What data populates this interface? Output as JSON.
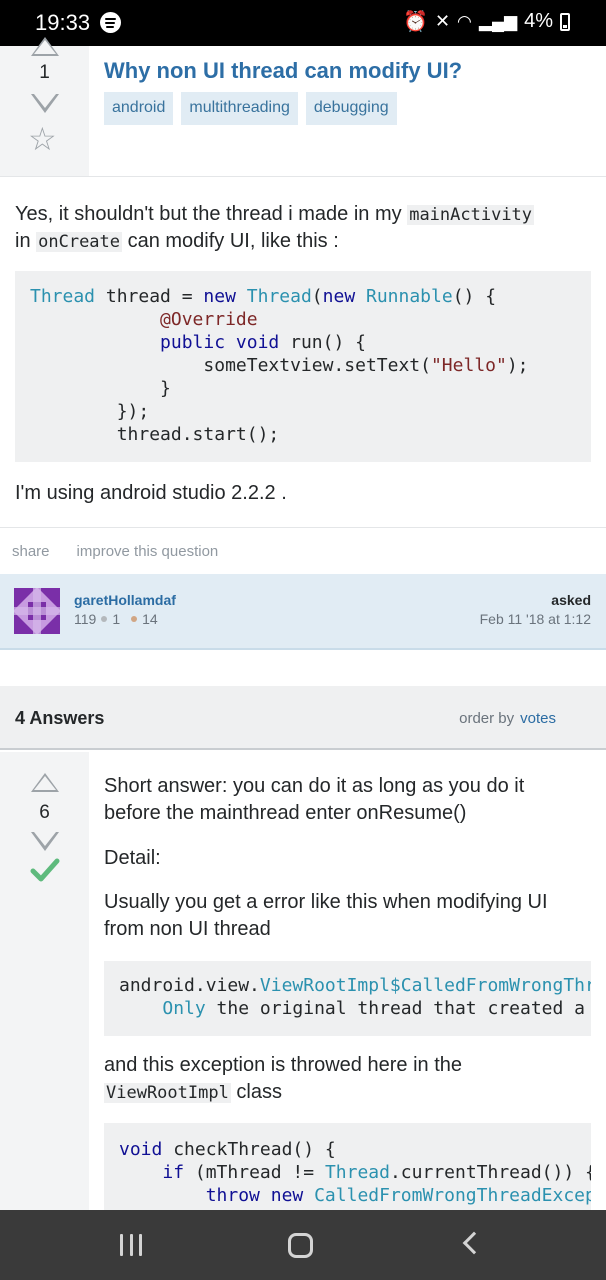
{
  "status_bar": {
    "time": "19:33",
    "battery": "4%"
  },
  "question": {
    "votes": "1",
    "title": "Why non UI thread can modify UI?",
    "tags": [
      "android",
      "multithreading",
      "debugging"
    ],
    "body_line1_a": "Yes, it shouldn't but the thread i made in my ",
    "body_code1": "mainActivity",
    "body_line2_a": "in ",
    "body_code2": "onCreate",
    "body_line2_b": " can modify UI, like this :",
    "code_lines": [
      "Thread thread = new Thread(new Runnable() {",
      "            @Override",
      "            public void run() {",
      "                someTextview.setText(\"Hello\");",
      "            }",
      "        });",
      "        thread.start();"
    ],
    "body_after_code": "I'm using android studio 2.2.2 .",
    "actions": {
      "share": "share",
      "improve": "improve this question"
    },
    "owner": {
      "name": "garetHollamdaf",
      "reputation": "119",
      "silver": "1",
      "bronze": "14",
      "asked_label": "asked",
      "asked_date": "Feb 11 '18 at 1:12"
    }
  },
  "answers_header": {
    "count_label": "4 Answers",
    "order_label": "order by",
    "order_value": "votes"
  },
  "answer": {
    "votes": "6",
    "accepted": true,
    "p1": "Short answer: you can do it as long as you do it before the mainthread enter onResume()",
    "p2": "Detail:",
    "p3": "Usually you get a error like this when modifying UI from non UI thread",
    "code1_lines": [
      "android.view.ViewRootImpl$CalledFromWrongThreadException:",
      "    Only the original thread that created a view hierarchy"
    ],
    "p4_a": "and this exception is throwed here in the ",
    "p4_code": "ViewRootImpl",
    "p4_b": " class",
    "code2_lines": [
      "void checkThread() {",
      "    if (mThread != Thread.currentThread()) {",
      "        throw new CalledFromWrongThreadException("
    ]
  },
  "colors": {
    "link": "#2d6ea6",
    "tag_bg": "#e1ecf4",
    "tag_text": "#39739d",
    "accepted": "#5eba7d",
    "owner_bg": "#e1ecf4"
  }
}
